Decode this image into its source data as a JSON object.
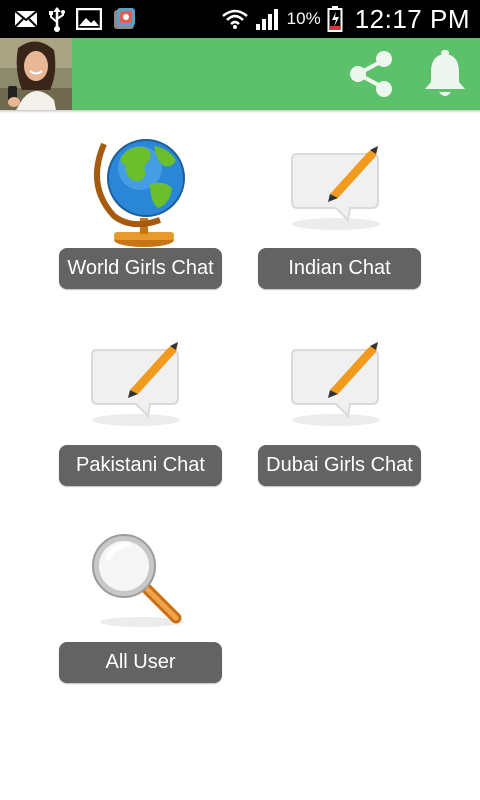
{
  "status_bar": {
    "battery_percent": "10%",
    "time": "12:17 PM",
    "icons": [
      "mail-icon",
      "usb-icon",
      "gallery-icon",
      "app-notification-icon",
      "wifi-icon",
      "signal-icon",
      "battery-icon"
    ]
  },
  "app_bar": {
    "color": "#5cc16a",
    "avatar_icon": "profile-avatar",
    "actions": [
      "share-icon",
      "bell-icon"
    ]
  },
  "menu": {
    "items": [
      {
        "label": "World Girls Chat",
        "icon": "globe-icon"
      },
      {
        "label": "Indian Chat",
        "icon": "chat-edit-icon"
      },
      {
        "label": "Pakistani Chat",
        "icon": "chat-edit-icon"
      },
      {
        "label": "Dubai Girls Chat",
        "icon": "chat-edit-icon"
      },
      {
        "label": "All User",
        "icon": "search-icon"
      }
    ],
    "button_color": "#636363"
  }
}
